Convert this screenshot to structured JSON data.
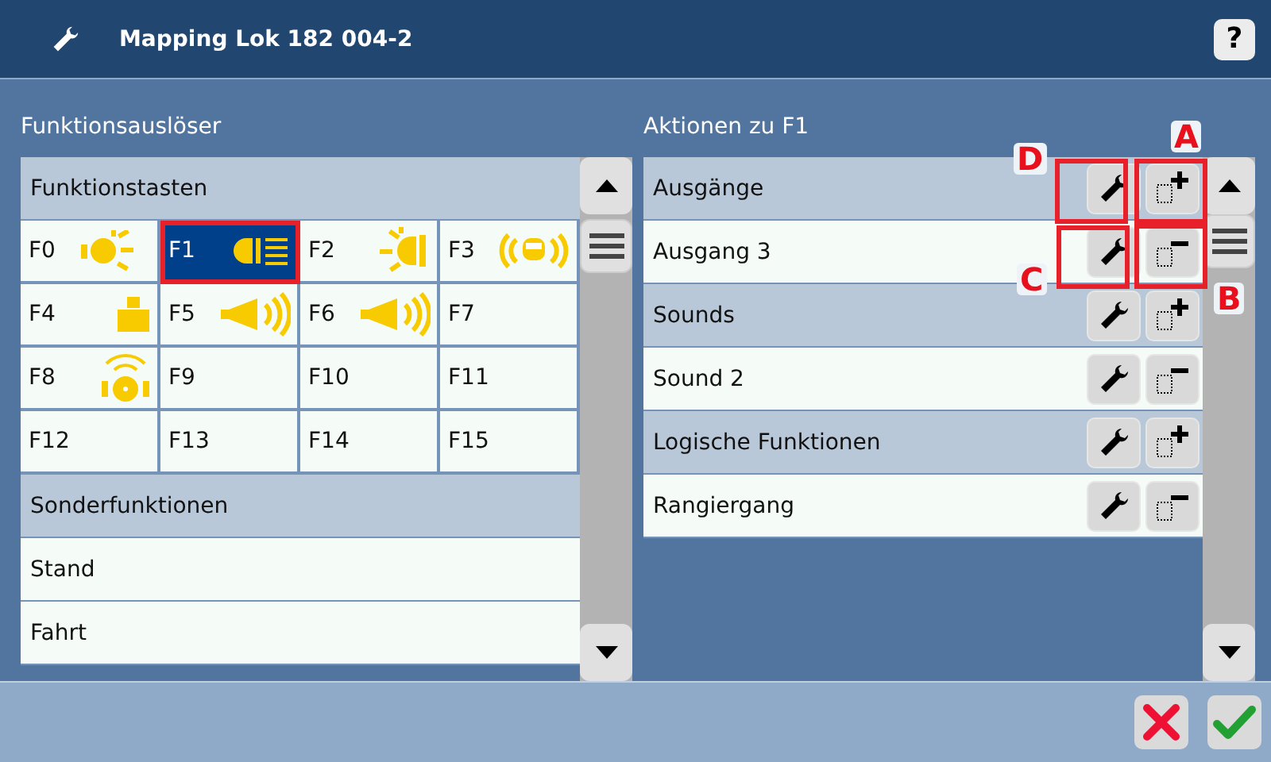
{
  "window": {
    "title": "Mapping Lok 182 004-2",
    "help": "?"
  },
  "left": {
    "title": "Funktionsauslöser",
    "groups": [
      {
        "header": "Funktionstasten",
        "kind": "grid",
        "items": [
          {
            "label": "F0",
            "selected": false
          },
          {
            "label": "F1",
            "selected": true
          },
          {
            "label": "F2",
            "selected": false
          },
          {
            "label": "F3",
            "selected": false
          },
          {
            "label": "F4",
            "selected": false
          },
          {
            "label": "F5",
            "selected": false
          },
          {
            "label": "F6",
            "selected": false
          },
          {
            "label": "F7",
            "selected": false
          },
          {
            "label": "F8",
            "selected": false
          },
          {
            "label": "F9",
            "selected": false
          },
          {
            "label": "F10",
            "selected": false
          },
          {
            "label": "F11",
            "selected": false
          },
          {
            "label": "F12",
            "selected": false
          },
          {
            "label": "F13",
            "selected": false
          },
          {
            "label": "F14",
            "selected": false
          },
          {
            "label": "F15",
            "selected": false
          }
        ]
      },
      {
        "header": "Sonderfunktionen",
        "kind": "list",
        "items": [
          {
            "label": "Stand",
            "selected": false
          },
          {
            "label": "Fahrt",
            "selected": false
          }
        ]
      }
    ]
  },
  "right": {
    "title": "Aktionen zu F1",
    "rows": [
      {
        "label": "Ausgänge",
        "kind": "group"
      },
      {
        "label": "Ausgang 3",
        "kind": "item"
      },
      {
        "label": "Sounds",
        "kind": "group"
      },
      {
        "label": "Sound 2",
        "kind": "item"
      },
      {
        "label": "Logische Funktionen",
        "kind": "group"
      },
      {
        "label": "Rangiergang",
        "kind": "item"
      }
    ]
  },
  "annotations": [
    {
      "label": "D"
    },
    {
      "label": "A"
    },
    {
      "label": "C"
    },
    {
      "label": "B"
    }
  ]
}
